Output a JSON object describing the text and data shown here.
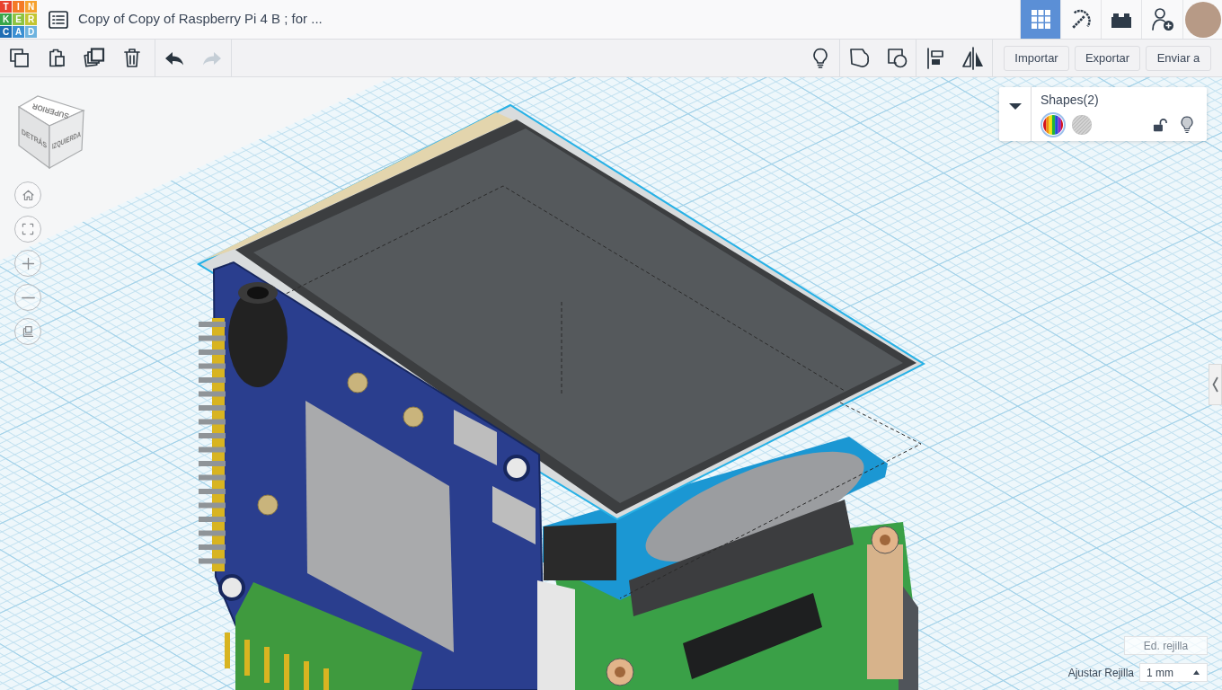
{
  "logo": {
    "tiles": [
      {
        "letter": "T",
        "color": "#e8412e"
      },
      {
        "letter": "I",
        "color": "#f47a26"
      },
      {
        "letter": "N",
        "color": "#f6a12e"
      },
      {
        "letter": "K",
        "color": "#3aa64a"
      },
      {
        "letter": "E",
        "color": "#8dc342"
      },
      {
        "letter": "R",
        "color": "#c3c532"
      },
      {
        "letter": "C",
        "color": "#1e6db4"
      },
      {
        "letter": "A",
        "color": "#3a8fd2"
      },
      {
        "letter": "D",
        "color": "#6eb3df"
      }
    ]
  },
  "header": {
    "title": "Copy of Copy of Raspberry Pi 4 B ; for ...",
    "views": [
      {
        "kind": "grid",
        "selected": true
      },
      {
        "kind": "pickaxe",
        "selected": false
      },
      {
        "kind": "bricks",
        "selected": false
      }
    ]
  },
  "toolbar": {
    "edit_tools": [
      {
        "kind": "copy"
      },
      {
        "kind": "paste"
      },
      {
        "kind": "duplicate"
      },
      {
        "kind": "delete"
      }
    ],
    "history": [
      {
        "kind": "undo",
        "disabled": false
      },
      {
        "kind": "redo",
        "disabled": true
      }
    ],
    "shape_tools": [
      {
        "kind": "bulb"
      },
      {
        "kind": "group"
      },
      {
        "kind": "combine"
      },
      {
        "kind": "align"
      },
      {
        "kind": "mirror"
      }
    ],
    "buttons": [
      "Importar",
      "Exportar",
      "Enviar a"
    ]
  },
  "view_cube": {
    "faces": [
      {
        "kind": "top",
        "label": "SUPERIOR"
      },
      {
        "kind": "back",
        "label": "DETRÁS"
      },
      {
        "kind": "left",
        "label": "IZQUIERDA"
      }
    ]
  },
  "view_controls": [
    {
      "kind": "home"
    },
    {
      "kind": "fit"
    },
    {
      "kind": "zoom_in"
    },
    {
      "kind": "zoom_out"
    },
    {
      "kind": "ortho"
    }
  ],
  "inspector": {
    "expanded": true,
    "title": "Shapes(2)",
    "swatches": [
      {
        "kind": "solid",
        "selected": true
      },
      {
        "kind": "hole",
        "selected": false
      }
    ],
    "locked": false
  },
  "grid_controls": {
    "edit_button": "Ed. rejilla",
    "snap_label": "Ajustar Rejilla",
    "snap_value": "1 mm"
  }
}
